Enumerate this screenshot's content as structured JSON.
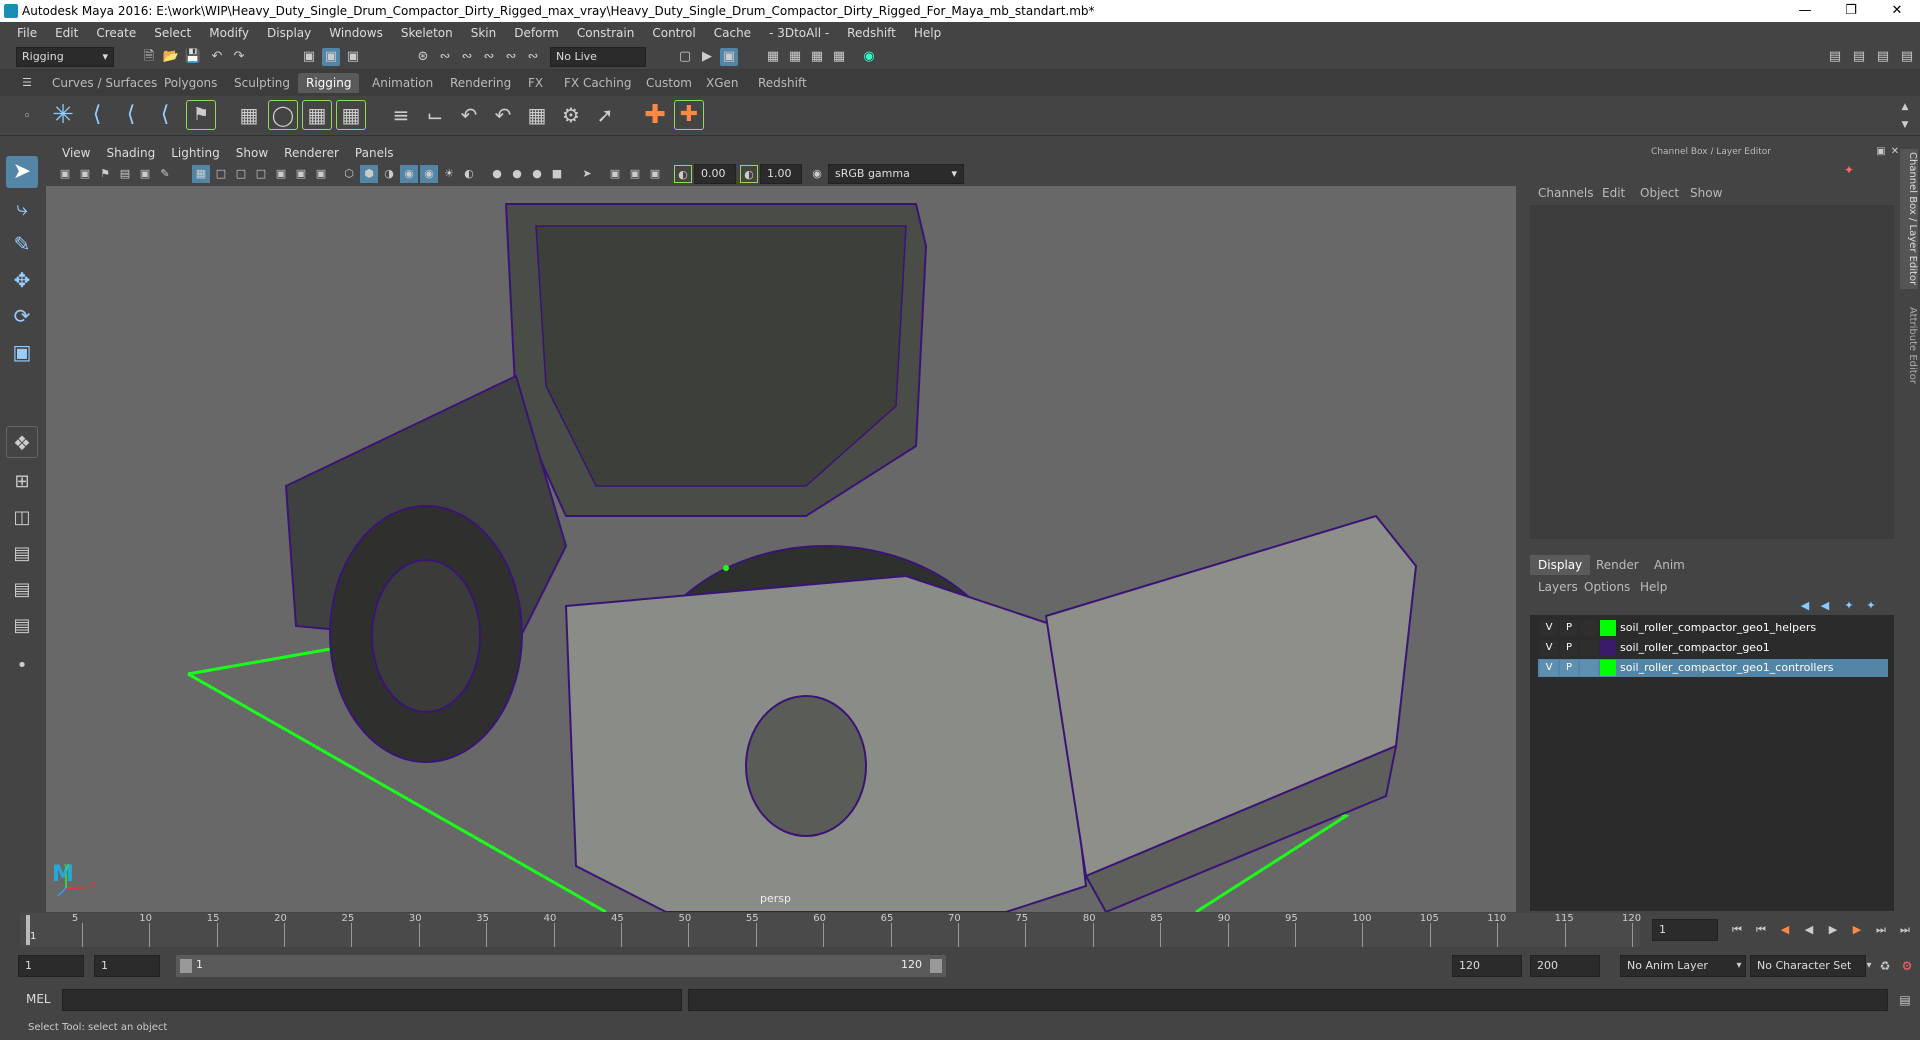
{
  "title": "Autodesk Maya 2016: E:\\work\\WIP\\Heavy_Duty_Single_Drum_Compactor_Dirty_Rigged_max_vray\\Heavy_Duty_Single_Drum_Compactor_Dirty_Rigged_For_Maya_mb_standart.mb*",
  "menu": [
    "File",
    "Edit",
    "Create",
    "Select",
    "Modify",
    "Display",
    "Windows",
    "Skeleton",
    "Skin",
    "Deform",
    "Constrain",
    "Control",
    "Cache",
    "- 3DtoAll -",
    "Redshift",
    "Help"
  ],
  "toolbar": {
    "mode": "Rigging",
    "live_surface": "No Live Surface"
  },
  "shelf_tabs": [
    "Curves / Surfaces",
    "Polygons",
    "Sculpting",
    "Rigging",
    "Animation",
    "Rendering",
    "FX",
    "FX Caching",
    "Custom",
    "XGen",
    "Redshift"
  ],
  "active_shelf": "Rigging",
  "viewport": {
    "menu": [
      "View",
      "Shading",
      "Lighting",
      "Show",
      "Renderer",
      "Panels"
    ],
    "exposure": "0.00",
    "gamma": "1.00",
    "color_space": "sRGB gamma",
    "camera_label": "persp",
    "axis_x": "x",
    "axis_y": "y"
  },
  "channel_box": {
    "title": "Channel Box / Layer Editor",
    "menu": [
      "Channels",
      "Edit",
      "Object",
      "Show"
    ]
  },
  "layer_editor": {
    "tabs": [
      "Display",
      "Render",
      "Anim"
    ],
    "active_tab": "Display",
    "menu": [
      "Layers",
      "Options",
      "Help"
    ],
    "layers": [
      {
        "v": "V",
        "p": "P",
        "color": "#00ff00",
        "name": "soil_roller_compactor_geo1_helpers",
        "selected": false
      },
      {
        "v": "V",
        "p": "P",
        "color": "#3a1a6a",
        "name": "soil_roller_compactor_geo1",
        "selected": false
      },
      {
        "v": "V",
        "p": "P",
        "color": "#00ff00",
        "name": "soil_roller_compactor_geo1_controllers",
        "selected": true
      }
    ]
  },
  "side_tabs": [
    "Channel Box / Layer Editor",
    "Attribute Editor"
  ],
  "timeline": {
    "ticks": [
      "5",
      "10",
      "15",
      "20",
      "25",
      "30",
      "35",
      "40",
      "45",
      "50",
      "55",
      "60",
      "65",
      "70",
      "75",
      "80",
      "85",
      "90",
      "95",
      "100",
      "105",
      "110",
      "115",
      "120"
    ],
    "start_label": "1",
    "current_frame": "1"
  },
  "range": {
    "start": "1",
    "current": "1",
    "slider_start": "1",
    "slider_end": "120",
    "end": "120",
    "max": "200",
    "anim_layer": "No Anim Layer",
    "character_set": "No Character Set"
  },
  "command": {
    "label": "MEL"
  },
  "help_line": "Select Tool: select an object",
  "colors": {
    "accent_selected": "#5285a6",
    "layer_green": "#00ff00",
    "wire_purple": "#3a1475",
    "ground_grid": "#00ff00"
  }
}
